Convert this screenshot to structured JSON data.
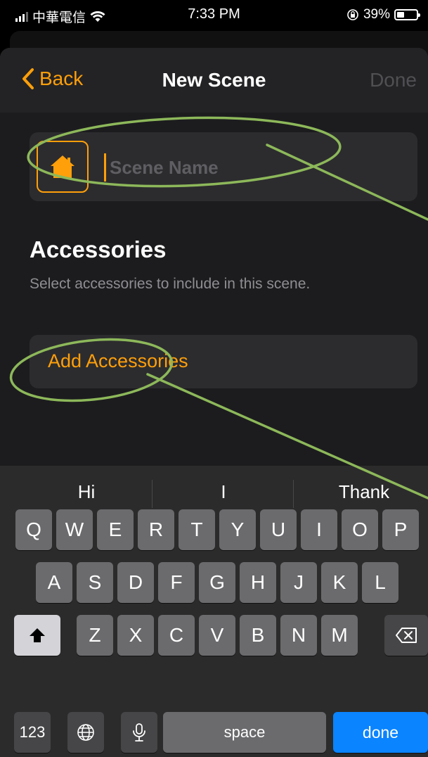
{
  "status_bar": {
    "carrier": "中華電信",
    "time": "7:33 PM",
    "battery": "39%"
  },
  "nav": {
    "back_label": "Back",
    "title": "New Scene",
    "done_label": "Done"
  },
  "scene_name": {
    "placeholder": "Scene Name",
    "value": ""
  },
  "accessories": {
    "title": "Accessories",
    "subtitle": "Select accessories to include in this scene.",
    "add_label": "Add Accessories"
  },
  "keyboard": {
    "predictions": [
      "Hi",
      "I",
      "Thank"
    ],
    "row1": [
      "Q",
      "W",
      "E",
      "R",
      "T",
      "Y",
      "U",
      "I",
      "O",
      "P"
    ],
    "row2": [
      "A",
      "S",
      "D",
      "F",
      "G",
      "H",
      "J",
      "K",
      "L"
    ],
    "row3": [
      "Z",
      "X",
      "C",
      "V",
      "B",
      "N",
      "M"
    ],
    "numbers_label": "123",
    "space_label": "space",
    "return_label": "done"
  },
  "colors": {
    "accent": "#ff9f0a",
    "annotation": "#8db85a",
    "return_key": "#0a84ff"
  },
  "icons": [
    "back-chevron-icon",
    "home-icon",
    "shift-icon",
    "backspace-icon",
    "globe-icon",
    "microphone-icon",
    "wifi-icon",
    "lock-rotation-icon",
    "battery-icon"
  ]
}
